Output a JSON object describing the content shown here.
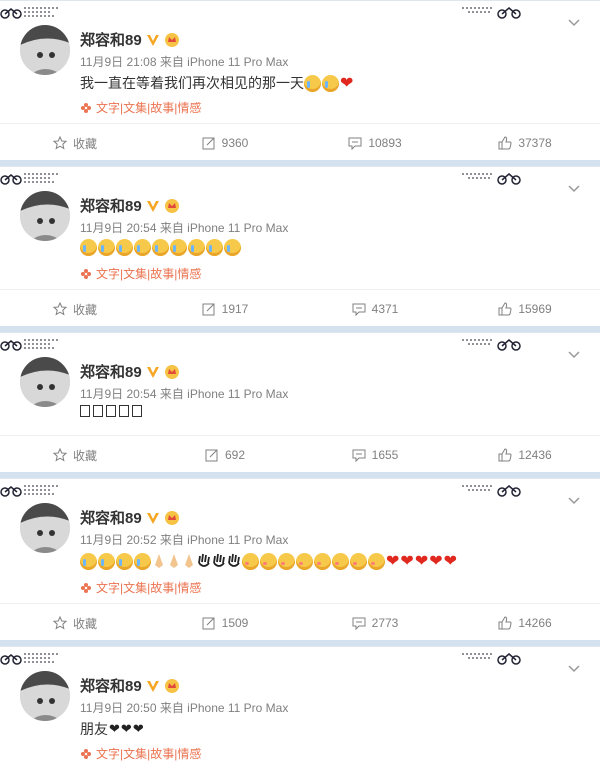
{
  "posts": [
    {
      "author": "郑容和89",
      "time": "11月9日 21:08",
      "source": "来自 iPhone 11 Pro Max",
      "text": "我一直在等着我们再次相见的那一天",
      "tag": "文字|文集|故事|情感",
      "actions": {
        "fav": "收藏",
        "repost": "9360",
        "comment": "10893",
        "like": "37378"
      }
    },
    {
      "author": "郑容和89",
      "time": "11月9日 20:54",
      "source": "来自 iPhone 11 Pro Max",
      "tag": "文字|文集|故事|情感",
      "actions": {
        "fav": "收藏",
        "repost": "1917",
        "comment": "4371",
        "like": "15969"
      }
    },
    {
      "author": "郑容和89",
      "time": "11月9日 20:54",
      "source": "来自 iPhone 11 Pro Max",
      "actions": {
        "fav": "收藏",
        "repost": "692",
        "comment": "1655",
        "like": "12436"
      }
    },
    {
      "author": "郑容和89",
      "time": "11月9日 20:52",
      "source": "来自 iPhone 11 Pro Max",
      "tag": "文字|文集|故事|情感",
      "actions": {
        "fav": "收藏",
        "repost": "1509",
        "comment": "2773",
        "like": "14266"
      }
    },
    {
      "author": "郑容和89",
      "time": "11月9日 20:50",
      "source": "来自 iPhone 11 Pro Max",
      "text": "朋友",
      "tag": "文字|文集|故事|情感"
    }
  ],
  "colors": {
    "accent": "#eb7350",
    "heart": "#e0281e",
    "background": "#d4e2ef"
  }
}
